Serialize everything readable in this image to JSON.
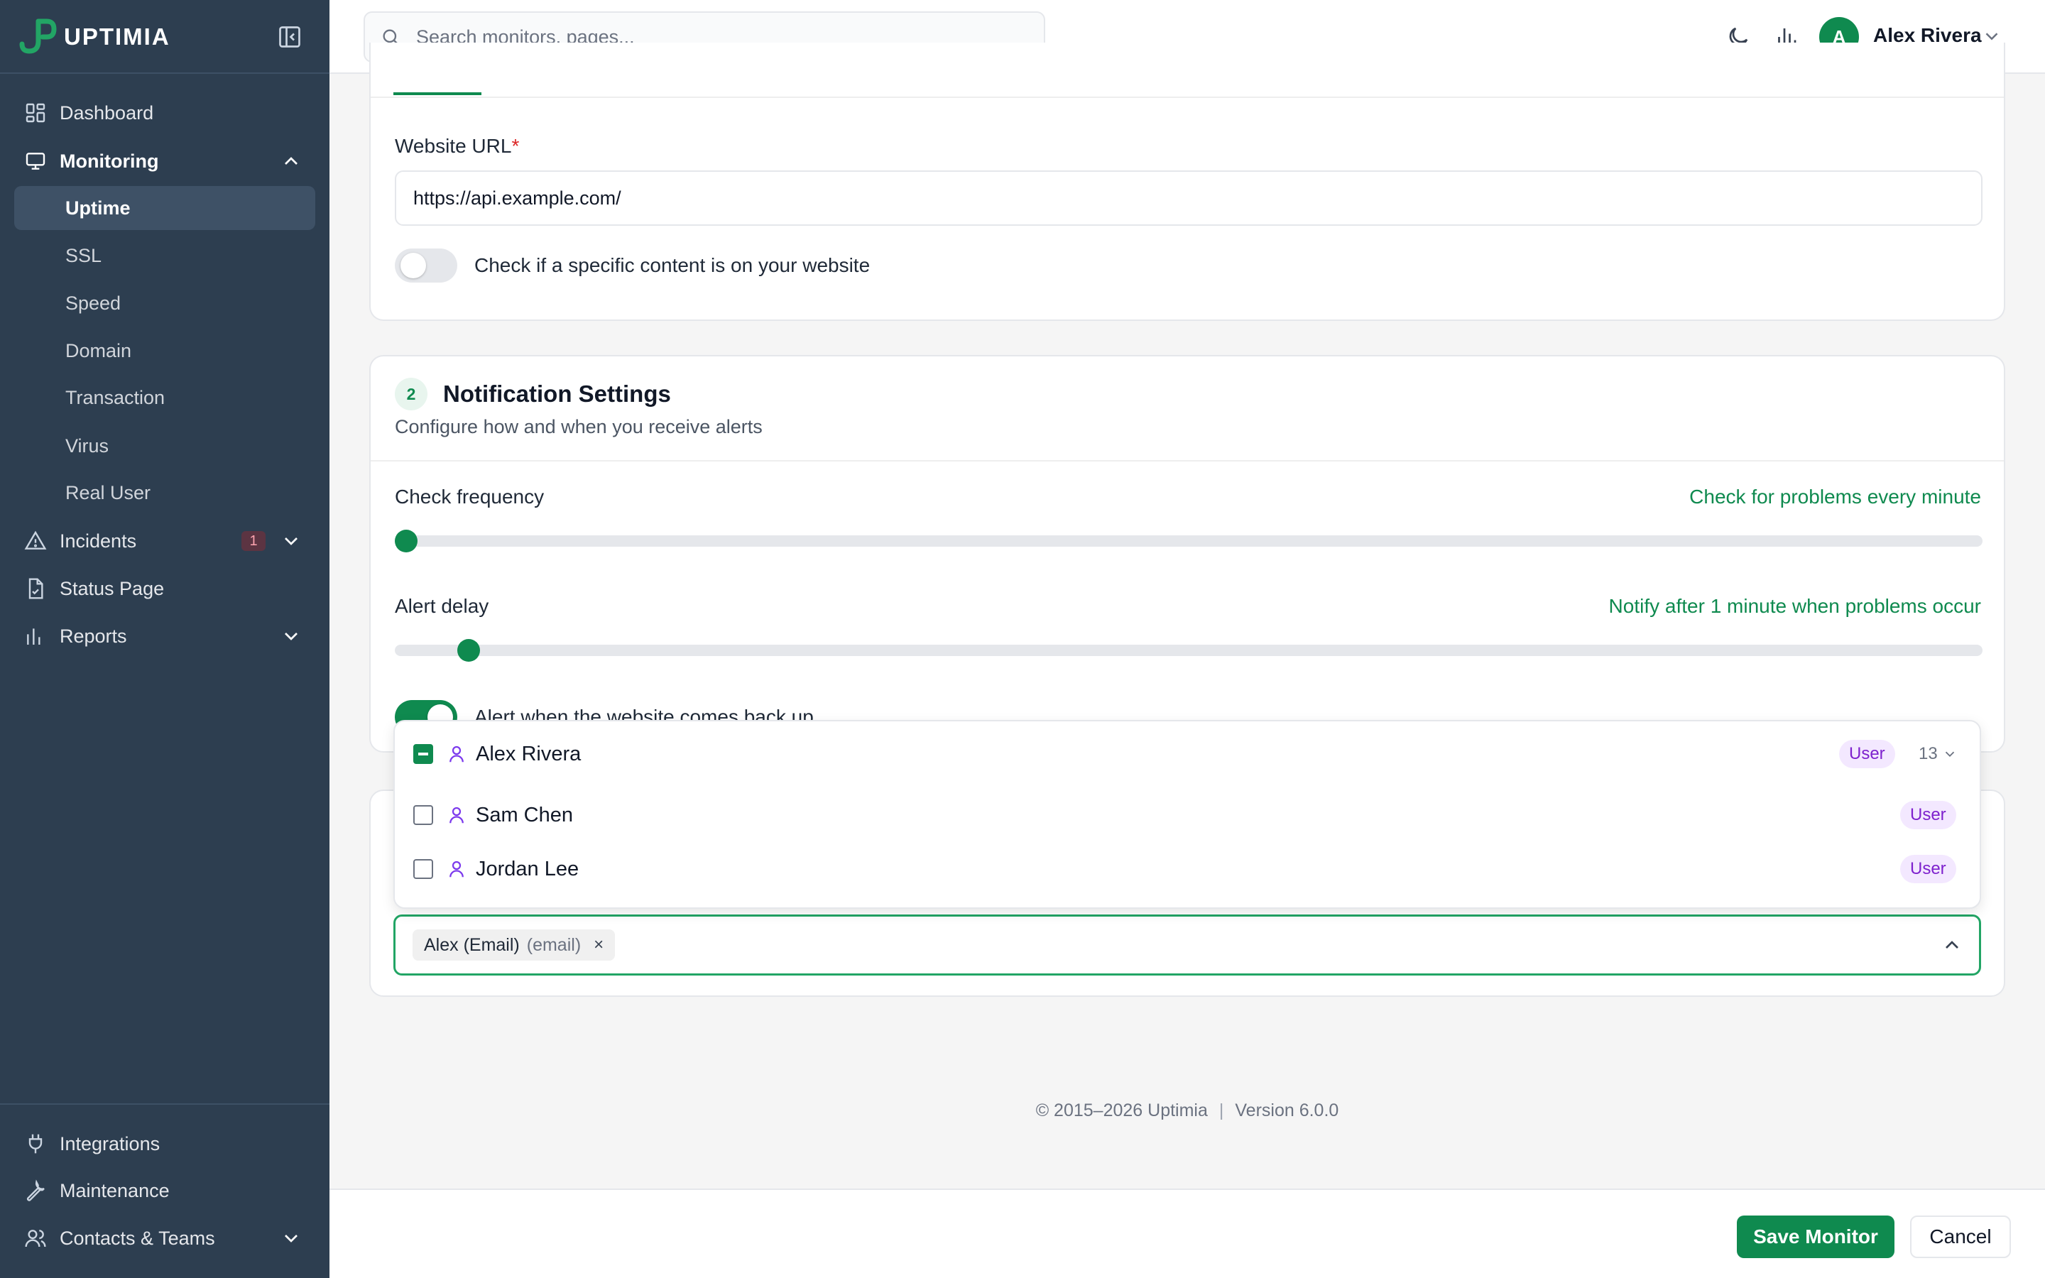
{
  "app": {
    "name": "UPTIMIA"
  },
  "sidebar": {
    "items": [
      {
        "label": "Dashboard",
        "icon": "dashboard-icon"
      },
      {
        "label": "Monitoring",
        "icon": "monitor-icon",
        "expanded": true
      },
      {
        "label": "Incidents",
        "icon": "alert-triangle-icon",
        "badge": "1"
      },
      {
        "label": "Status Page",
        "icon": "document-icon"
      },
      {
        "label": "Reports",
        "icon": "bar-chart-icon"
      }
    ],
    "monitoring_sub": [
      "Uptime",
      "SSL",
      "Speed",
      "Domain",
      "Transaction",
      "Virus",
      "Real User"
    ],
    "active_sub": "Uptime",
    "bottom_items": [
      {
        "label": "Integrations",
        "icon": "plug-icon"
      },
      {
        "label": "Maintenance",
        "icon": "wrench-icon"
      },
      {
        "label": "Contacts & Teams",
        "icon": "users-icon"
      }
    ]
  },
  "topbar": {
    "search_placeholder": "Search monitors, pages...",
    "user_name": "Alex Rivera",
    "user_initial": "A"
  },
  "section1": {
    "url_label": "Website URL",
    "url_required_mark": "*",
    "url_value": "https://api.example.com/",
    "content_check_label": "Check if a specific content is on your website",
    "content_check_on": false
  },
  "section2": {
    "step": "2",
    "title": "Notification Settings",
    "subtitle": "Configure how and when you receive alerts",
    "check_frequency_label": "Check frequency",
    "check_frequency_value": "Check for problems every minute",
    "check_frequency_level": 0,
    "alert_delay_label": "Alert delay",
    "alert_delay_value": "Notify after 1 minute when problems occur",
    "alert_delay_level": 0.04,
    "back_up_label": "Alert when the website comes back up",
    "back_up_on": true
  },
  "contacts_dropdown": {
    "options": [
      {
        "name": "Alex Rivera",
        "role": "User",
        "state": "indeterminate",
        "count": "13"
      },
      {
        "name": "Sam Chen",
        "role": "User",
        "state": "unchecked"
      },
      {
        "name": "Jordan Lee",
        "role": "User",
        "state": "unchecked"
      }
    ]
  },
  "contacts_select": {
    "chip_name": "Alex (Email)",
    "chip_type": "(email)",
    "chip_remove": "×"
  },
  "footer": {
    "copyright": "© 2015–2026 Uptimia",
    "separator": "|",
    "version": "Version 6.0.0"
  },
  "actions": {
    "save": "Save Monitor",
    "cancel": "Cancel"
  },
  "colors": {
    "sidebar_bg": "#2d3e50",
    "accent": "#0f8a4f",
    "role_badge": "#7e22ce"
  }
}
